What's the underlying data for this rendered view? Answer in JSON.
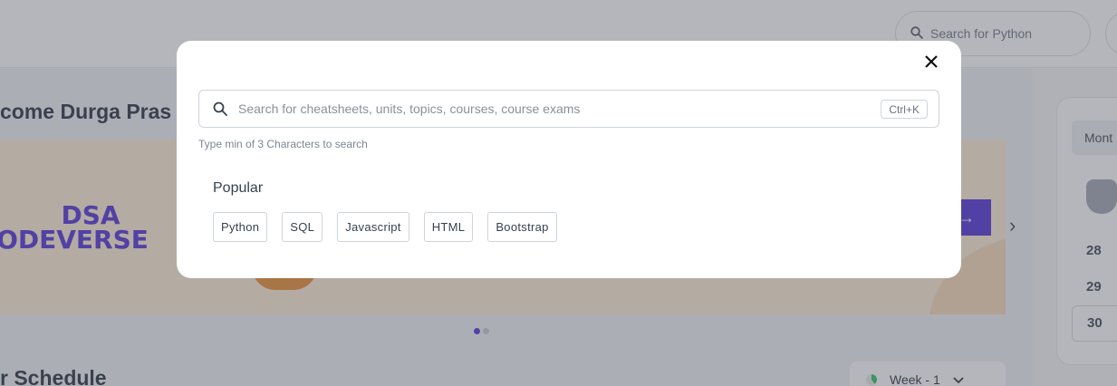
{
  "header": {
    "search_placeholder": "Search for Python"
  },
  "dashboard": {
    "welcome_text": "come Durga Pras",
    "banner": {
      "title_line1": "DSA",
      "title_line2": "ODEVERSE",
      "cta_icon": "arrow-right-icon"
    },
    "carousel": {
      "count": 2,
      "active_index": 0
    },
    "schedule_title": "r Schedule",
    "week_select": "Week - 1"
  },
  "calendar_panel": {
    "tab_label": "Mont",
    "dates": [
      "28",
      "29",
      "30"
    ],
    "selected_date": "30"
  },
  "search_modal": {
    "search_placeholder": "Search for cheatsheets, units, topics, courses, course exams",
    "search_value": "",
    "shortcut": "Ctrl+K",
    "hint": "Type min of 3 Characters to search",
    "popular_title": "Popular",
    "popular_items": [
      "Python",
      "SQL",
      "Javascript",
      "HTML",
      "Bootstrap"
    ]
  },
  "colors": {
    "brand": "#4b2bd6",
    "overlay": "#5a5e69"
  }
}
